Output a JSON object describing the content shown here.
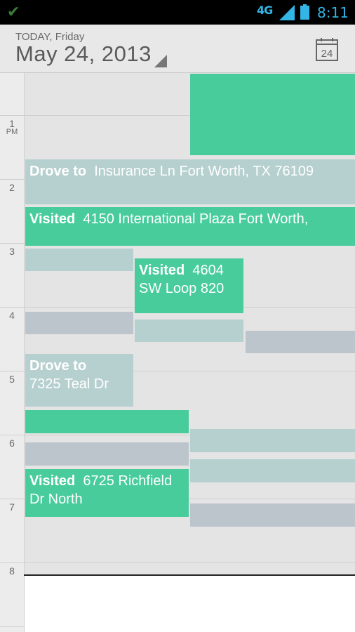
{
  "status": {
    "network": "4G",
    "time": "8:11"
  },
  "header": {
    "today_label": "TODAY, Friday",
    "date": "May 24, 2013",
    "calendar_day": "24"
  },
  "hours": [
    {
      "label": "1",
      "sub": "PM"
    },
    {
      "label": "2",
      "sub": ""
    },
    {
      "label": "3",
      "sub": ""
    },
    {
      "label": "4",
      "sub": ""
    },
    {
      "label": "5",
      "sub": ""
    },
    {
      "label": "6",
      "sub": ""
    },
    {
      "label": "7",
      "sub": ""
    },
    {
      "label": "8",
      "sub": ""
    }
  ],
  "events": {
    "drove_insurance": {
      "kind": "Drove to",
      "detail": "Insurance Ln  Fort Worth, TX 76109"
    },
    "visited_international": {
      "kind": "Visited",
      "detail": "4150 International Plaza  Fort Worth,"
    },
    "visited_sw_loop": {
      "kind": "Visited",
      "detail": "4604 SW Loop 820"
    },
    "drove_teal": {
      "kind": "Drove to",
      "detail": "7325 Teal Dr"
    },
    "visited_richfield": {
      "kind": "Visited",
      "detail": "6725 Richfield Dr  North"
    }
  },
  "colors": {
    "visited": "#48cc9c",
    "drove": "#b6cfcf",
    "other": "#bcc5cc",
    "accent": "#33b5e5"
  }
}
